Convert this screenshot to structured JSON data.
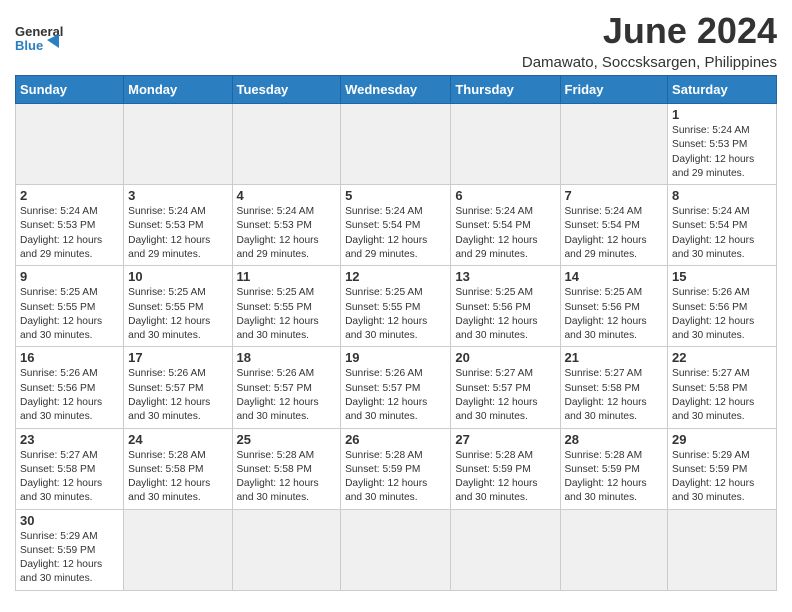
{
  "header": {
    "logo_general": "General",
    "logo_blue": "Blue",
    "month_year": "June 2024",
    "location": "Damawato, Soccsksargen, Philippines"
  },
  "weekdays": [
    "Sunday",
    "Monday",
    "Tuesday",
    "Wednesday",
    "Thursday",
    "Friday",
    "Saturday"
  ],
  "weeks": [
    [
      {
        "day": "",
        "info": ""
      },
      {
        "day": "",
        "info": ""
      },
      {
        "day": "",
        "info": ""
      },
      {
        "day": "",
        "info": ""
      },
      {
        "day": "",
        "info": ""
      },
      {
        "day": "",
        "info": ""
      },
      {
        "day": "1",
        "info": "Sunrise: 5:24 AM\nSunset: 5:53 PM\nDaylight: 12 hours and 29 minutes."
      }
    ],
    [
      {
        "day": "2",
        "info": "Sunrise: 5:24 AM\nSunset: 5:53 PM\nDaylight: 12 hours and 29 minutes."
      },
      {
        "day": "3",
        "info": "Sunrise: 5:24 AM\nSunset: 5:53 PM\nDaylight: 12 hours and 29 minutes."
      },
      {
        "day": "4",
        "info": "Sunrise: 5:24 AM\nSunset: 5:53 PM\nDaylight: 12 hours and 29 minutes."
      },
      {
        "day": "5",
        "info": "Sunrise: 5:24 AM\nSunset: 5:54 PM\nDaylight: 12 hours and 29 minutes."
      },
      {
        "day": "6",
        "info": "Sunrise: 5:24 AM\nSunset: 5:54 PM\nDaylight: 12 hours and 29 minutes."
      },
      {
        "day": "7",
        "info": "Sunrise: 5:24 AM\nSunset: 5:54 PM\nDaylight: 12 hours and 29 minutes."
      },
      {
        "day": "8",
        "info": "Sunrise: 5:24 AM\nSunset: 5:54 PM\nDaylight: 12 hours and 30 minutes."
      }
    ],
    [
      {
        "day": "9",
        "info": "Sunrise: 5:25 AM\nSunset: 5:55 PM\nDaylight: 12 hours and 30 minutes."
      },
      {
        "day": "10",
        "info": "Sunrise: 5:25 AM\nSunset: 5:55 PM\nDaylight: 12 hours and 30 minutes."
      },
      {
        "day": "11",
        "info": "Sunrise: 5:25 AM\nSunset: 5:55 PM\nDaylight: 12 hours and 30 minutes."
      },
      {
        "day": "12",
        "info": "Sunrise: 5:25 AM\nSunset: 5:55 PM\nDaylight: 12 hours and 30 minutes."
      },
      {
        "day": "13",
        "info": "Sunrise: 5:25 AM\nSunset: 5:56 PM\nDaylight: 12 hours and 30 minutes."
      },
      {
        "day": "14",
        "info": "Sunrise: 5:25 AM\nSunset: 5:56 PM\nDaylight: 12 hours and 30 minutes."
      },
      {
        "day": "15",
        "info": "Sunrise: 5:26 AM\nSunset: 5:56 PM\nDaylight: 12 hours and 30 minutes."
      }
    ],
    [
      {
        "day": "16",
        "info": "Sunrise: 5:26 AM\nSunset: 5:56 PM\nDaylight: 12 hours and 30 minutes."
      },
      {
        "day": "17",
        "info": "Sunrise: 5:26 AM\nSunset: 5:57 PM\nDaylight: 12 hours and 30 minutes."
      },
      {
        "day": "18",
        "info": "Sunrise: 5:26 AM\nSunset: 5:57 PM\nDaylight: 12 hours and 30 minutes."
      },
      {
        "day": "19",
        "info": "Sunrise: 5:26 AM\nSunset: 5:57 PM\nDaylight: 12 hours and 30 minutes."
      },
      {
        "day": "20",
        "info": "Sunrise: 5:27 AM\nSunset: 5:57 PM\nDaylight: 12 hours and 30 minutes."
      },
      {
        "day": "21",
        "info": "Sunrise: 5:27 AM\nSunset: 5:58 PM\nDaylight: 12 hours and 30 minutes."
      },
      {
        "day": "22",
        "info": "Sunrise: 5:27 AM\nSunset: 5:58 PM\nDaylight: 12 hours and 30 minutes."
      }
    ],
    [
      {
        "day": "23",
        "info": "Sunrise: 5:27 AM\nSunset: 5:58 PM\nDaylight: 12 hours and 30 minutes."
      },
      {
        "day": "24",
        "info": "Sunrise: 5:28 AM\nSunset: 5:58 PM\nDaylight: 12 hours and 30 minutes."
      },
      {
        "day": "25",
        "info": "Sunrise: 5:28 AM\nSunset: 5:58 PM\nDaylight: 12 hours and 30 minutes."
      },
      {
        "day": "26",
        "info": "Sunrise: 5:28 AM\nSunset: 5:59 PM\nDaylight: 12 hours and 30 minutes."
      },
      {
        "day": "27",
        "info": "Sunrise: 5:28 AM\nSunset: 5:59 PM\nDaylight: 12 hours and 30 minutes."
      },
      {
        "day": "28",
        "info": "Sunrise: 5:28 AM\nSunset: 5:59 PM\nDaylight: 12 hours and 30 minutes."
      },
      {
        "day": "29",
        "info": "Sunrise: 5:29 AM\nSunset: 5:59 PM\nDaylight: 12 hours and 30 minutes."
      }
    ],
    [
      {
        "day": "30",
        "info": "Sunrise: 5:29 AM\nSunset: 5:59 PM\nDaylight: 12 hours and 30 minutes."
      },
      {
        "day": "",
        "info": ""
      },
      {
        "day": "",
        "info": ""
      },
      {
        "day": "",
        "info": ""
      },
      {
        "day": "",
        "info": ""
      },
      {
        "day": "",
        "info": ""
      },
      {
        "day": "",
        "info": ""
      }
    ]
  ]
}
